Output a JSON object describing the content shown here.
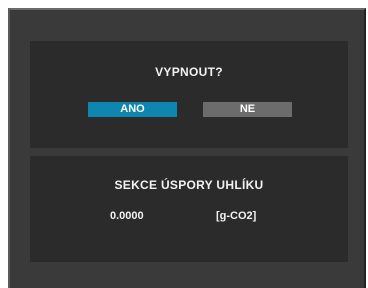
{
  "dialog": {
    "question": "VYPNOUT?",
    "yes_label": "ANO",
    "no_label": "NE"
  },
  "carbon": {
    "title": "SEKCE ÚSPORY UHLÍKU",
    "value": "0.0000",
    "unit": "[g-CO2]"
  },
  "colors": {
    "selected_button": "#0f86b0",
    "unselected_button": "#6c6c6c",
    "panel_bg": "#2b2b2b",
    "frame_bg": "#3a3a3a",
    "text": "#f2f2f2"
  }
}
